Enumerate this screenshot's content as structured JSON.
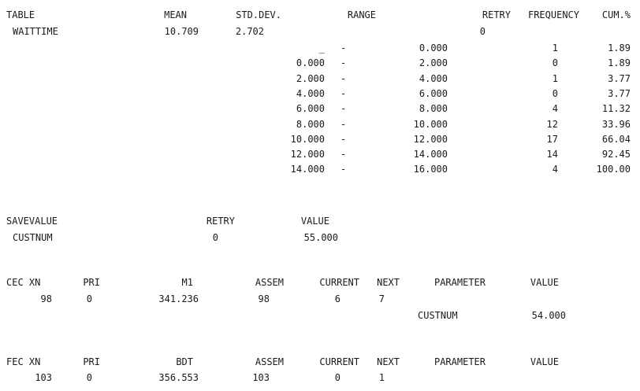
{
  "table": {
    "headers": {
      "table": "TABLE",
      "mean": "MEAN",
      "std_dev": "STD.DEV.",
      "range": "RANGE",
      "retry": "RETRY",
      "frequency": "FREQUENCY",
      "cum_pct": "CUM.%"
    },
    "name": "WAITTIME",
    "mean": "10.709",
    "std_dev": "2.702",
    "retry": "0",
    "rows": [
      {
        "low": "_",
        "dash": "-",
        "high": "0.000",
        "freq": "1",
        "cum": "1.89"
      },
      {
        "low": "0.000",
        "dash": "-",
        "high": "2.000",
        "freq": "0",
        "cum": "1.89"
      },
      {
        "low": "2.000",
        "dash": "-",
        "high": "4.000",
        "freq": "1",
        "cum": "3.77"
      },
      {
        "low": "4.000",
        "dash": "-",
        "high": "6.000",
        "freq": "0",
        "cum": "3.77"
      },
      {
        "low": "6.000",
        "dash": "-",
        "high": "8.000",
        "freq": "4",
        "cum": "11.32"
      },
      {
        "low": "8.000",
        "dash": "-",
        "high": "10.000",
        "freq": "12",
        "cum": "33.96"
      },
      {
        "low": "10.000",
        "dash": "-",
        "high": "12.000",
        "freq": "17",
        "cum": "66.04"
      },
      {
        "low": "12.000",
        "dash": "-",
        "high": "14.000",
        "freq": "14",
        "cum": "92.45"
      },
      {
        "low": "14.000",
        "dash": "-",
        "high": "16.000",
        "freq": "4",
        "cum": "100.00"
      }
    ]
  },
  "savevalue": {
    "headers": {
      "savevalue": "SAVEVALUE",
      "retry": "RETRY",
      "value": "VALUE"
    },
    "name": "CUSTNUM",
    "retry": "0",
    "value": "55.000"
  },
  "cec": {
    "headers": {
      "xn": "CEC XN",
      "pri": "PRI",
      "m1": "M1",
      "assem": "ASSEM",
      "current": "CURRENT",
      "next": "NEXT",
      "parameter": "PARAMETER",
      "value": "VALUE"
    },
    "xn": "98",
    "pri": "0",
    "m1": "341.236",
    "assem": "98",
    "current": "6",
    "next": "7",
    "parameter": "CUSTNUM",
    "value": "54.000"
  },
  "fec": {
    "headers": {
      "xn": "FEC XN",
      "pri": "PRI",
      "bdt": "BDT",
      "assem": "ASSEM",
      "current": "CURRENT",
      "next": "NEXT",
      "parameter": "PARAMETER",
      "value": "VALUE"
    },
    "xn": "103",
    "pri": "0",
    "bdt": "356.553",
    "assem": "103",
    "current": "0",
    "next": "1"
  }
}
